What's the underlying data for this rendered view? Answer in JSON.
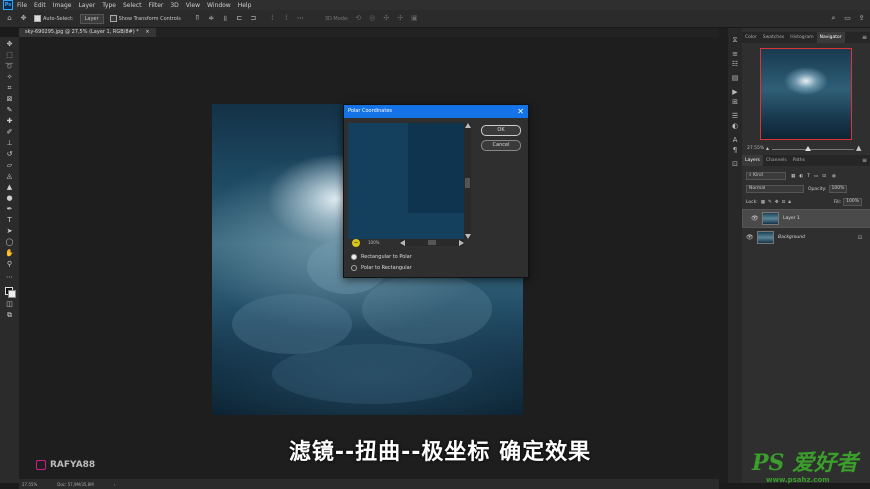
{
  "menubar": {
    "logo": "Ps",
    "items": [
      "File",
      "Edit",
      "Image",
      "Layer",
      "Type",
      "Select",
      "Filter",
      "3D",
      "View",
      "Window",
      "Help"
    ]
  },
  "options": {
    "auto_select_label": "Auto-Select:",
    "auto_select_target": "Layer",
    "show_transform_label": "Show Transform Controls",
    "three_d_mode": "3D Mode:"
  },
  "document": {
    "tab_title": "sky-690295.jpg @ 27,5% (Layer 1, RGB/8#) *",
    "tab_close": "×"
  },
  "dialog": {
    "title": "Polar Coordinates",
    "close": "✕",
    "ok": "OK",
    "cancel": "Cancel",
    "zoom_minus": "−",
    "zoom_value": "100%",
    "option_rect_to_polar": "Rectangular to Polar",
    "option_polar_to_rect": "Polar to Rectangular",
    "selected_option": "Rectangular to Polar"
  },
  "subtitle": "滤镜--扭曲--极坐标 确定效果",
  "watermark_left": "RAFYA88",
  "status": {
    "zoom": "27.55%",
    "doc": "Doc: 57,9M/35,8M",
    "arrow": "›"
  },
  "panels": {
    "top_tabs": [
      "Color",
      "Swatches",
      "Histogram",
      "Navigator"
    ],
    "active_top_tab": "Navigator",
    "nav_zoom": "27.55%",
    "layer_tabs": [
      "Layers",
      "Channels",
      "Paths"
    ],
    "active_layer_tab": "Layers",
    "kind_filter": "Kind",
    "blend_mode": "Normal",
    "opacity_label": "Opacity:",
    "opacity_value": "100%",
    "lock_label": "Lock:",
    "fill_label": "Fill:",
    "fill_value": "100%",
    "layers": [
      {
        "name": "Layer 1",
        "selected": true,
        "locked": false
      },
      {
        "name": "Background",
        "selected": false,
        "locked": true
      }
    ]
  },
  "site_watermark": {
    "big": "PS 爱好者",
    "small": "www.psahz.com"
  },
  "colors": {
    "accent": "#1473e6",
    "panel_bg": "#2f2f2f",
    "canvas_bg": "#1e1e1e",
    "watermark_green": "#3b9e2c"
  }
}
